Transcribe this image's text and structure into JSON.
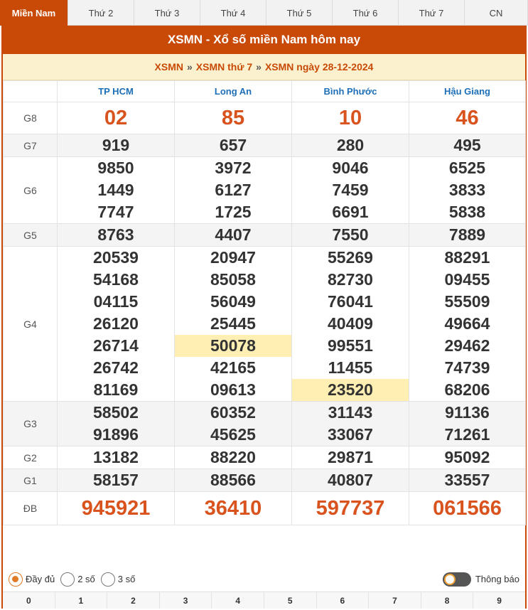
{
  "tabs": [
    {
      "label": "Miền Nam",
      "active": true
    },
    {
      "label": "Thứ 2"
    },
    {
      "label": "Thứ 3"
    },
    {
      "label": "Thứ 4"
    },
    {
      "label": "Thứ 5"
    },
    {
      "label": "Thứ 6"
    },
    {
      "label": "Thứ 7"
    },
    {
      "label": "CN"
    }
  ],
  "banner": {
    "title": "XSMN - Xổ số miền Nam hôm nay"
  },
  "breadcrumb": {
    "items": [
      "XSMN",
      "XSMN thứ 7",
      "XSMN ngày 28-12-2024"
    ],
    "separator": "»"
  },
  "provinces": [
    "TP HCM",
    "Long An",
    "Bình Phước",
    "Hậu Giang"
  ],
  "prizes": [
    {
      "name": "G8",
      "values": [
        [
          "02"
        ],
        [
          "85"
        ],
        [
          "10"
        ],
        [
          "46"
        ]
      ]
    },
    {
      "name": "G7",
      "values": [
        [
          "919"
        ],
        [
          "657"
        ],
        [
          "280"
        ],
        [
          "495"
        ]
      ]
    },
    {
      "name": "G6",
      "values": [
        [
          "9850",
          "1449",
          "7747"
        ],
        [
          "3972",
          "6127",
          "1725"
        ],
        [
          "9046",
          "7459",
          "6691"
        ],
        [
          "6525",
          "3833",
          "5838"
        ]
      ]
    },
    {
      "name": "G5",
      "values": [
        [
          "8763"
        ],
        [
          "4407"
        ],
        [
          "7550"
        ],
        [
          "7889"
        ]
      ]
    },
    {
      "name": "G4",
      "values": [
        [
          "20539",
          "54168",
          "04115",
          "26120",
          "26714",
          "26742",
          "81169"
        ],
        [
          "20947",
          "85058",
          "56049",
          "25445",
          "50078",
          "42165",
          "09613"
        ],
        [
          "55269",
          "82730",
          "76041",
          "40409",
          "99551",
          "11455",
          "23520"
        ],
        [
          "88291",
          "09455",
          "55509",
          "49664",
          "29462",
          "74739",
          "68206"
        ]
      ]
    },
    {
      "name": "G3",
      "values": [
        [
          "58502",
          "91896"
        ],
        [
          "60352",
          "45625"
        ],
        [
          "31143",
          "33067"
        ],
        [
          "91136",
          "71261"
        ]
      ]
    },
    {
      "name": "G2",
      "values": [
        [
          "13182"
        ],
        [
          "88220"
        ],
        [
          "29871"
        ],
        [
          "95092"
        ]
      ]
    },
    {
      "name": "G1",
      "values": [
        [
          "58157"
        ],
        [
          "88566"
        ],
        [
          "40807"
        ],
        [
          "33557"
        ]
      ]
    },
    {
      "name": "ĐB",
      "values": [
        [
          "945921"
        ],
        [
          "36410"
        ],
        [
          "597737"
        ],
        [
          "061566"
        ]
      ]
    }
  ],
  "highlights": [
    {
      "prize": "G4",
      "col": 1,
      "index": 4
    },
    {
      "prize": "G4",
      "col": 2,
      "index": 6
    }
  ],
  "display_options": {
    "options": [
      "Đầy đủ",
      "2 số",
      "3 số"
    ],
    "selected": "Đầy đủ"
  },
  "notify": {
    "label": "Thông báo"
  },
  "digits": [
    "0",
    "1",
    "2",
    "3",
    "4",
    "5",
    "6",
    "7",
    "8",
    "9"
  ],
  "colors": {
    "brand": "#c94a06",
    "prize_red": "#d9531e",
    "province_blue": "#1d6fb8",
    "highlight": "#ffefb3",
    "breadcrumb_bg": "#fbf1cf"
  }
}
